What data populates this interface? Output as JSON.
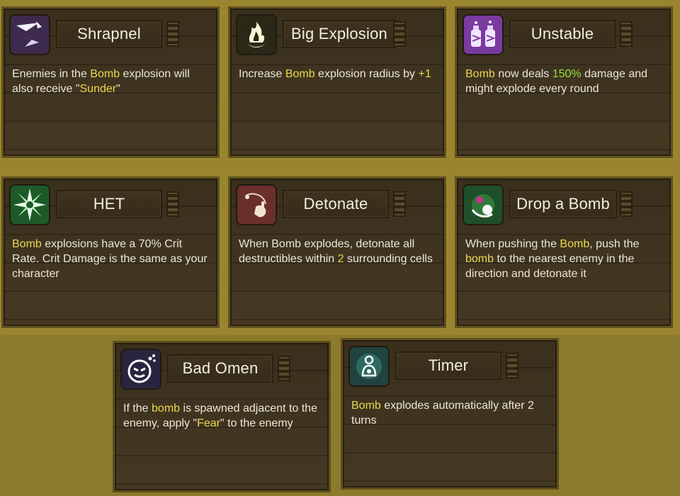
{
  "cards": [
    {
      "title": "Shrapnel",
      "icon": "shrapnel-icon",
      "desc": [
        {
          "t": "Enemies in the ",
          "c": ""
        },
        {
          "t": "Bomb",
          "c": "y"
        },
        {
          "t": " explosion will also receive \"",
          "c": ""
        },
        {
          "t": "Sunder",
          "c": "y"
        },
        {
          "t": "\"",
          "c": ""
        }
      ]
    },
    {
      "title": "Big Explosion",
      "icon": "big-explosion-icon",
      "desc": [
        {
          "t": "Increase ",
          "c": ""
        },
        {
          "t": "Bomb",
          "c": "y"
        },
        {
          "t": " explosion radius by ",
          "c": ""
        },
        {
          "t": "+1",
          "c": "y"
        }
      ]
    },
    {
      "title": "Unstable",
      "icon": "unstable-icon",
      "desc": [
        {
          "t": "Bomb",
          "c": "y"
        },
        {
          "t": " now deals ",
          "c": ""
        },
        {
          "t": "150%",
          "c": "g"
        },
        {
          "t": " damage and might explode every round",
          "c": ""
        }
      ]
    },
    {
      "title": "HET",
      "icon": "het-icon",
      "desc": [
        {
          "t": "Bomb",
          "c": "y"
        },
        {
          "t": " explosions have a 70% Crit Rate. Crit Damage is the same as your character",
          "c": ""
        }
      ]
    },
    {
      "title": "Detonate",
      "icon": "detonate-icon",
      "desc": [
        {
          "t": "When Bomb explodes, detonate all destructibles within  ",
          "c": ""
        },
        {
          "t": "2",
          "c": "y"
        },
        {
          "t": " surrounding cells",
          "c": ""
        }
      ]
    },
    {
      "title": "Drop a Bomb",
      "icon": "drop-bomb-icon",
      "desc": [
        {
          "t": "When pushing the ",
          "c": ""
        },
        {
          "t": "Bomb",
          "c": "y"
        },
        {
          "t": ", push the ",
          "c": ""
        },
        {
          "t": "bomb",
          "c": "y"
        },
        {
          "t": " to the nearest enemy in the direction and detonate it",
          "c": ""
        }
      ]
    },
    {
      "title": "Bad Omen",
      "icon": "bad-omen-icon",
      "desc": [
        {
          "t": "If the ",
          "c": ""
        },
        {
          "t": "bomb",
          "c": "y"
        },
        {
          "t": " is spawned adjacent to the enemy, apply \"",
          "c": ""
        },
        {
          "t": "Fear",
          "c": "y"
        },
        {
          "t": "\" to the enemy",
          "c": ""
        }
      ]
    },
    {
      "title": "Timer",
      "icon": "timer-icon",
      "desc": [
        {
          "t": "Bomb",
          "c": "y"
        },
        {
          "t": " explodes automatically after 2 turns",
          "c": ""
        }
      ]
    }
  ]
}
